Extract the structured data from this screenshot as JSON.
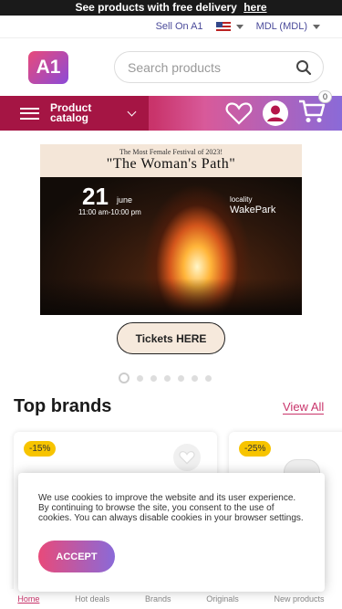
{
  "promo": {
    "text": "See products with free delivery",
    "link": "here"
  },
  "subbar": {
    "sell": "Sell On A1",
    "currency": "MDL (MDL)"
  },
  "header": {
    "logo": "A1",
    "search_placeholder": "Search products"
  },
  "nav": {
    "catalog_label": "Product catalog",
    "cart_count": "0"
  },
  "banner": {
    "headline_small": "The Most Female Festival of 2023!",
    "headline_big": "\"The Woman's Path\"",
    "day": "21",
    "month": "june",
    "time": "11:00 am-10:00 pm",
    "locality_label": "locality",
    "locality": "WakePark"
  },
  "tickets_label": "Tickets HERE",
  "brands": {
    "title": "Top brands",
    "view_all": "View All"
  },
  "cards": [
    {
      "discount": "-15%"
    },
    {
      "discount": "-25%"
    }
  ],
  "bottom_nav": [
    "Home",
    "Hot deals",
    "Brands",
    "Originals",
    "New products"
  ],
  "cookie": {
    "text": "We use cookies to improve the website and its user experience. By continuing to browse the site, you consent to the use of cookies. You can always disable cookies in your browser settings.",
    "accept": "ACCEPT"
  },
  "colors": {
    "accent": "#c9346b",
    "discount": "#f7c400"
  }
}
